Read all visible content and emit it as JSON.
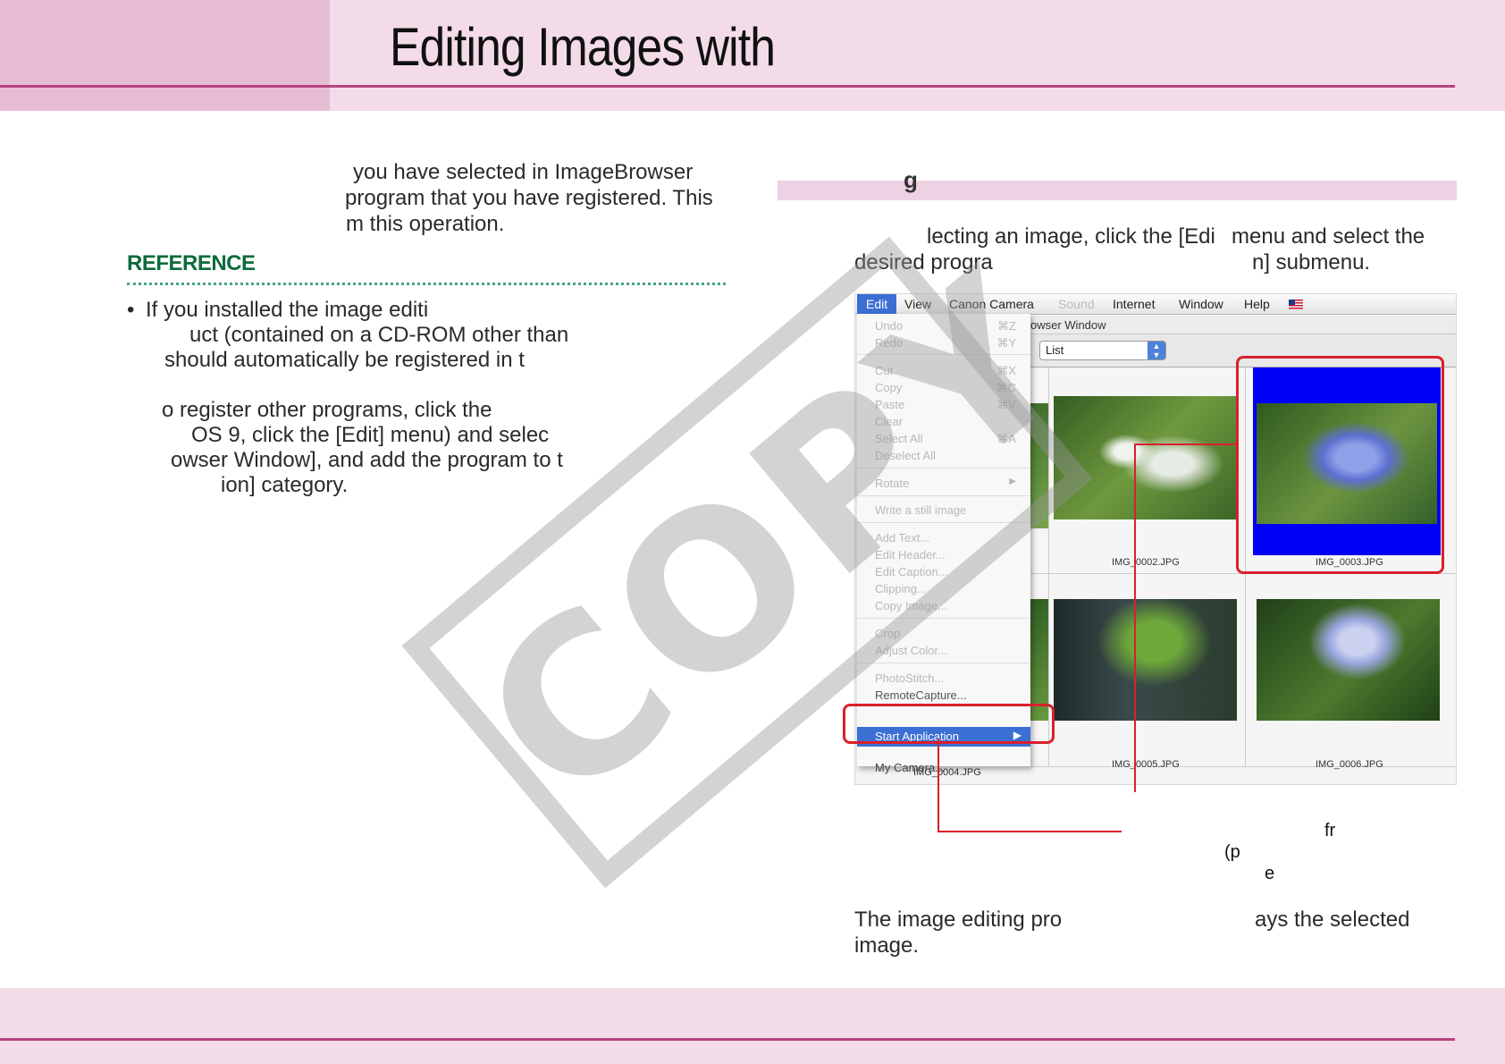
{
  "header": {
    "title": "Editing Images with"
  },
  "left_column": {
    "intro_lines": [
      "you have selected in ImageBrowser",
      "program that you have registered.  This",
      "m this operation."
    ],
    "reference": {
      "heading": "REFERENCE",
      "bullet": "•",
      "lines": [
        "If you installed the image editi",
        "uct (contained on a CD-ROM other than",
        "should automatically be registered in t",
        "o register other programs, click the",
        "OS 9, click the [Edit] menu) and selec",
        "owser Window], and add the program to t",
        "ion] category."
      ]
    }
  },
  "right_column": {
    "section_heading": "g",
    "step_lines": [
      "lecting an image, click the [Edi",
      "menu and select the",
      "desired progra",
      "n] submenu."
    ],
    "callout_lines": [
      "fr",
      "(p",
      "e"
    ],
    "result_lines": [
      "The image editing pro",
      "ays the selected",
      "image."
    ]
  },
  "screenshot": {
    "menubar": [
      "Edit",
      "View",
      "Canon Camera",
      "Sound",
      "Internet",
      "Window",
      "Help"
    ],
    "window_title": "owser Window",
    "view_select": "List",
    "edit_menu": {
      "items": [
        {
          "label": "Undo",
          "key": "⌘Z"
        },
        {
          "label": "Redo",
          "key": "⌘Y"
        },
        {
          "label": "Cut",
          "key": "⌘X"
        },
        {
          "label": "Copy",
          "key": "⌘C"
        },
        {
          "label": "Paste",
          "key": "⌘V"
        },
        {
          "label": "Clear",
          "key": ""
        },
        {
          "label": "Select All",
          "key": "⌘A"
        },
        {
          "label": "Deselect All",
          "key": ""
        },
        {
          "label": "Rotate",
          "key": "▶"
        },
        {
          "label": "Write a still image",
          "key": ""
        },
        {
          "label": "Add Text...",
          "key": ""
        },
        {
          "label": "Edit Header...",
          "key": ""
        },
        {
          "label": "Edit Caption...",
          "key": ""
        },
        {
          "label": "Clipping...",
          "key": ""
        },
        {
          "label": "Copy Image...",
          "key": ""
        },
        {
          "label": "Crop",
          "key": ""
        },
        {
          "label": "Adjust Color...",
          "key": ""
        },
        {
          "label": "PhotoStitch...",
          "key": ""
        },
        {
          "label": "RemoteCapture...",
          "key": ""
        }
      ],
      "start_application": "Start Application",
      "my_camera": "My Camera..."
    },
    "thumbnails": [
      "IMG_0002.JPG",
      "IMG_0003.JPG",
      "IMG_0004.JPG",
      "IMG_0005.JPG",
      "IMG_0006.JPG"
    ]
  },
  "watermark": "COPY",
  "colors": {
    "header_band": "#f3dce8",
    "header_tab": "#e6bcd5",
    "rule": "#b5457f",
    "reference_green": "#0d6b3b",
    "annotation_red": "#d9202c",
    "selection_blue": "#0000f5"
  }
}
